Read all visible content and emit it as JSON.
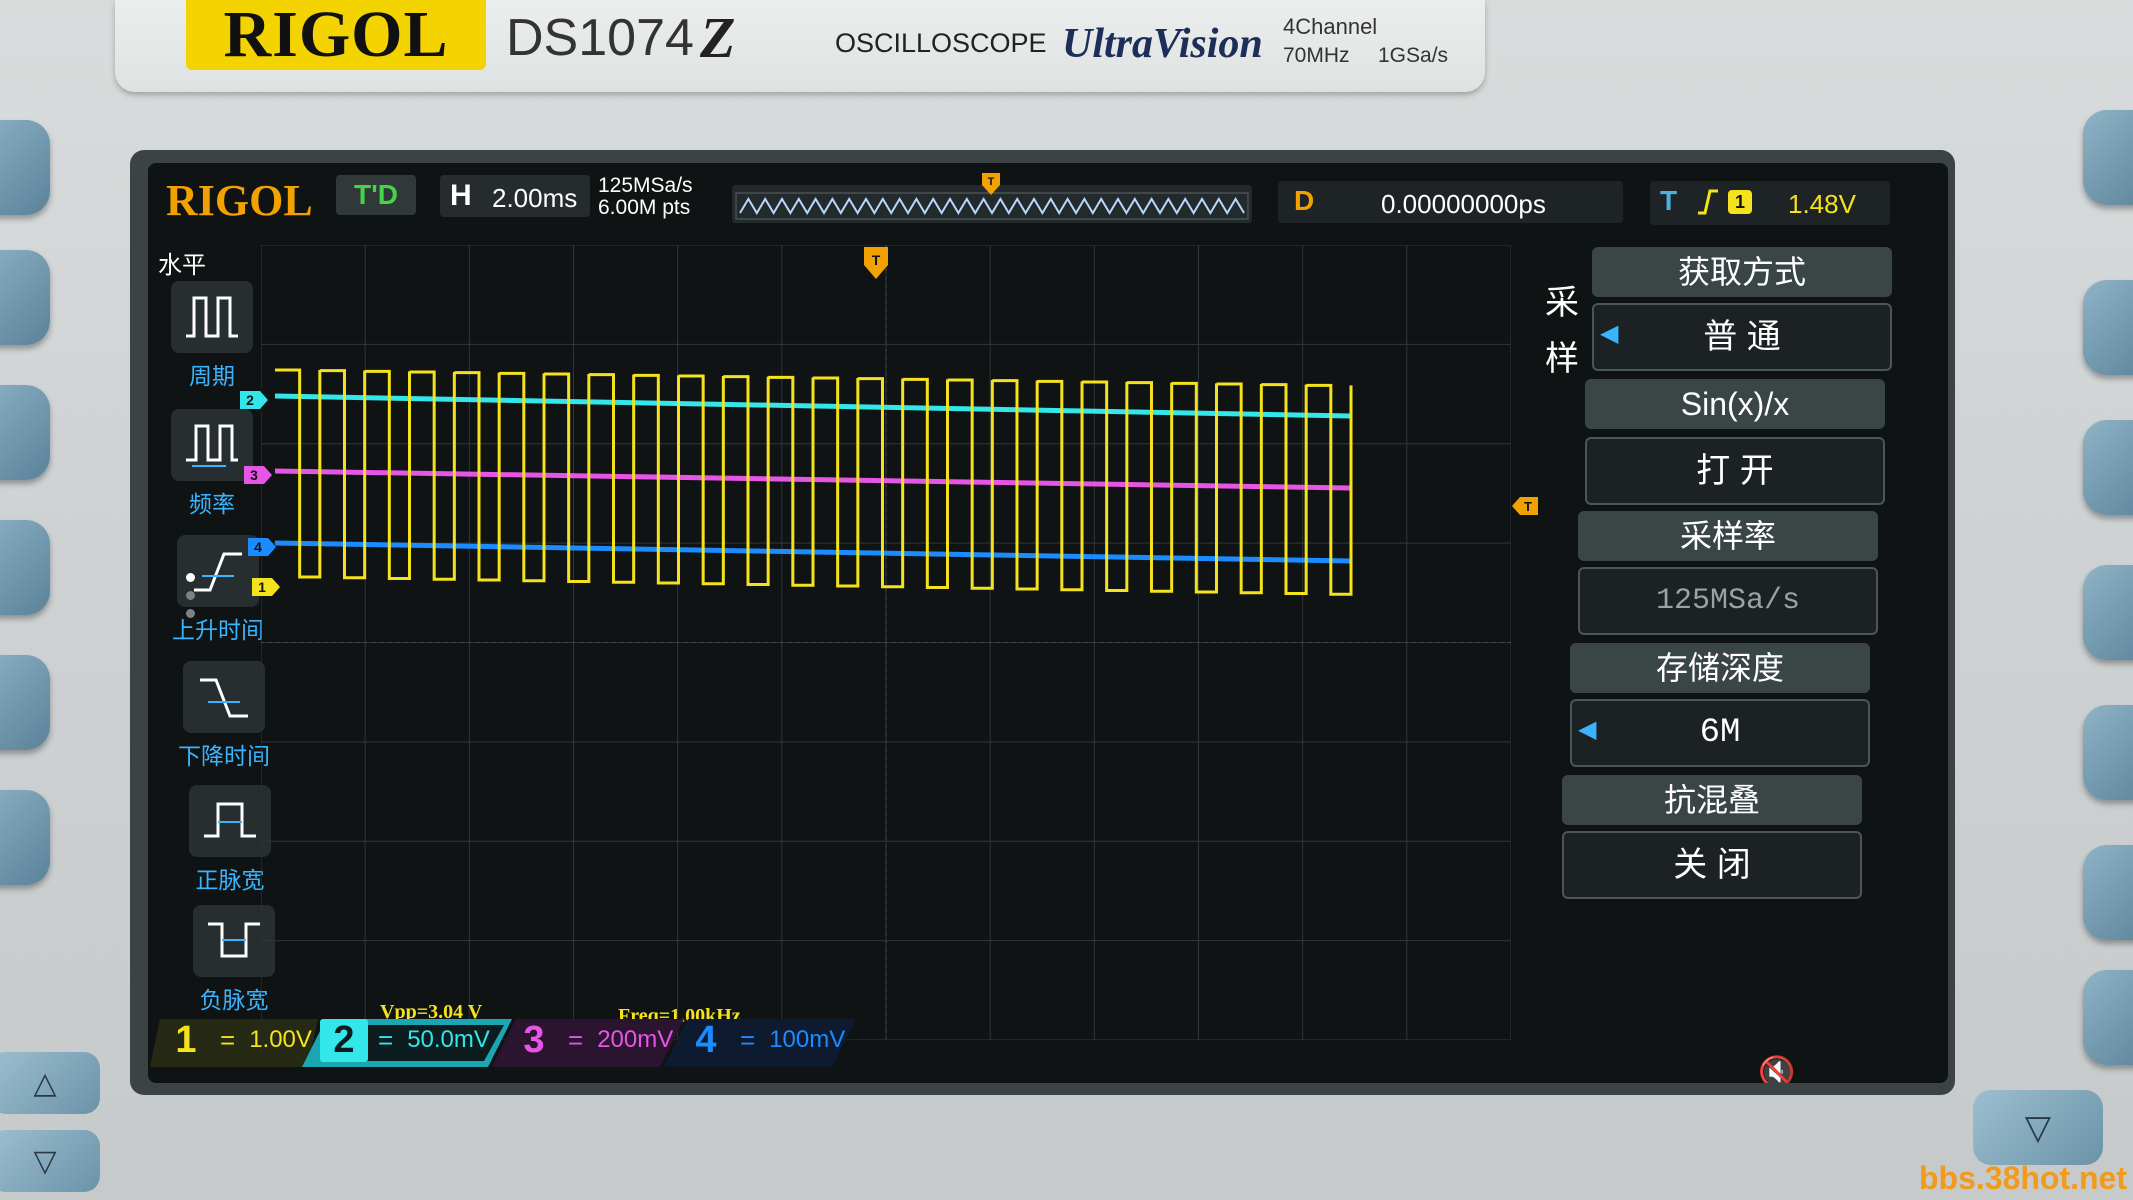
{
  "device": {
    "brand": "RIGOL",
    "model": "DS1074",
    "model_suffix": "Z",
    "kind": "OSCILLOSCOPE",
    "series": "UltraVision",
    "spec_channels": "4Channel",
    "spec_bandwidth": "70MHz",
    "spec_sample": "1GSa/s"
  },
  "status": {
    "logo": "RIGOL",
    "run_state": "T'D",
    "h_label": "H",
    "timebase": "2.00ms",
    "sample_rate": "125MSa/s",
    "memory_points": "6.00M pts",
    "delay_label": "D",
    "delay_value": "0.00000000ps",
    "trigger_label": "T",
    "trigger_channel": "1",
    "trigger_level": "1.48V"
  },
  "left_menu": {
    "header": "水平",
    "items": [
      "周期",
      "频率",
      "上升时间",
      "下降时间",
      "正脉宽",
      "负脉宽"
    ]
  },
  "right_menu": {
    "vertical_label_1": "采",
    "vertical_label_2": "样",
    "acq_title": "获取方式",
    "acq_value": "普 通",
    "sinx_title": "Sin(x)/x",
    "sinx_value": "打 开",
    "rate_title": "采样率",
    "rate_value": "125MSa/s",
    "depth_title": "存储深度",
    "depth_value": "6M",
    "alias_title": "抗混叠",
    "alias_value": "关 闭"
  },
  "measurements": {
    "vpp": "Vpp=3.04 V",
    "freq": "Freq=1.00kHz"
  },
  "channels": [
    {
      "num": "1",
      "coupling": "=",
      "scale": "1.00V",
      "color": "#f4e21c"
    },
    {
      "num": "2",
      "coupling": "=",
      "scale": "50.0mV",
      "color": "#33e6ea"
    },
    {
      "num": "3",
      "coupling": "=",
      "scale": "200mV",
      "color": "#e655e6"
    },
    {
      "num": "4",
      "coupling": "=",
      "scale": "100mV",
      "color": "#1a8cff"
    }
  ],
  "markers": {
    "ch1": "1",
    "ch2": "2",
    "ch3": "3",
    "ch4": "4",
    "trig": "T"
  },
  "waveform": {
    "ch1_type": "square",
    "ch1_cycles": 24,
    "ch2_type": "flat",
    "ch3_type": "flat",
    "ch4_type": "flat"
  },
  "icons": {
    "mute": "🔇"
  },
  "watermark": "bbs.38hot.net"
}
